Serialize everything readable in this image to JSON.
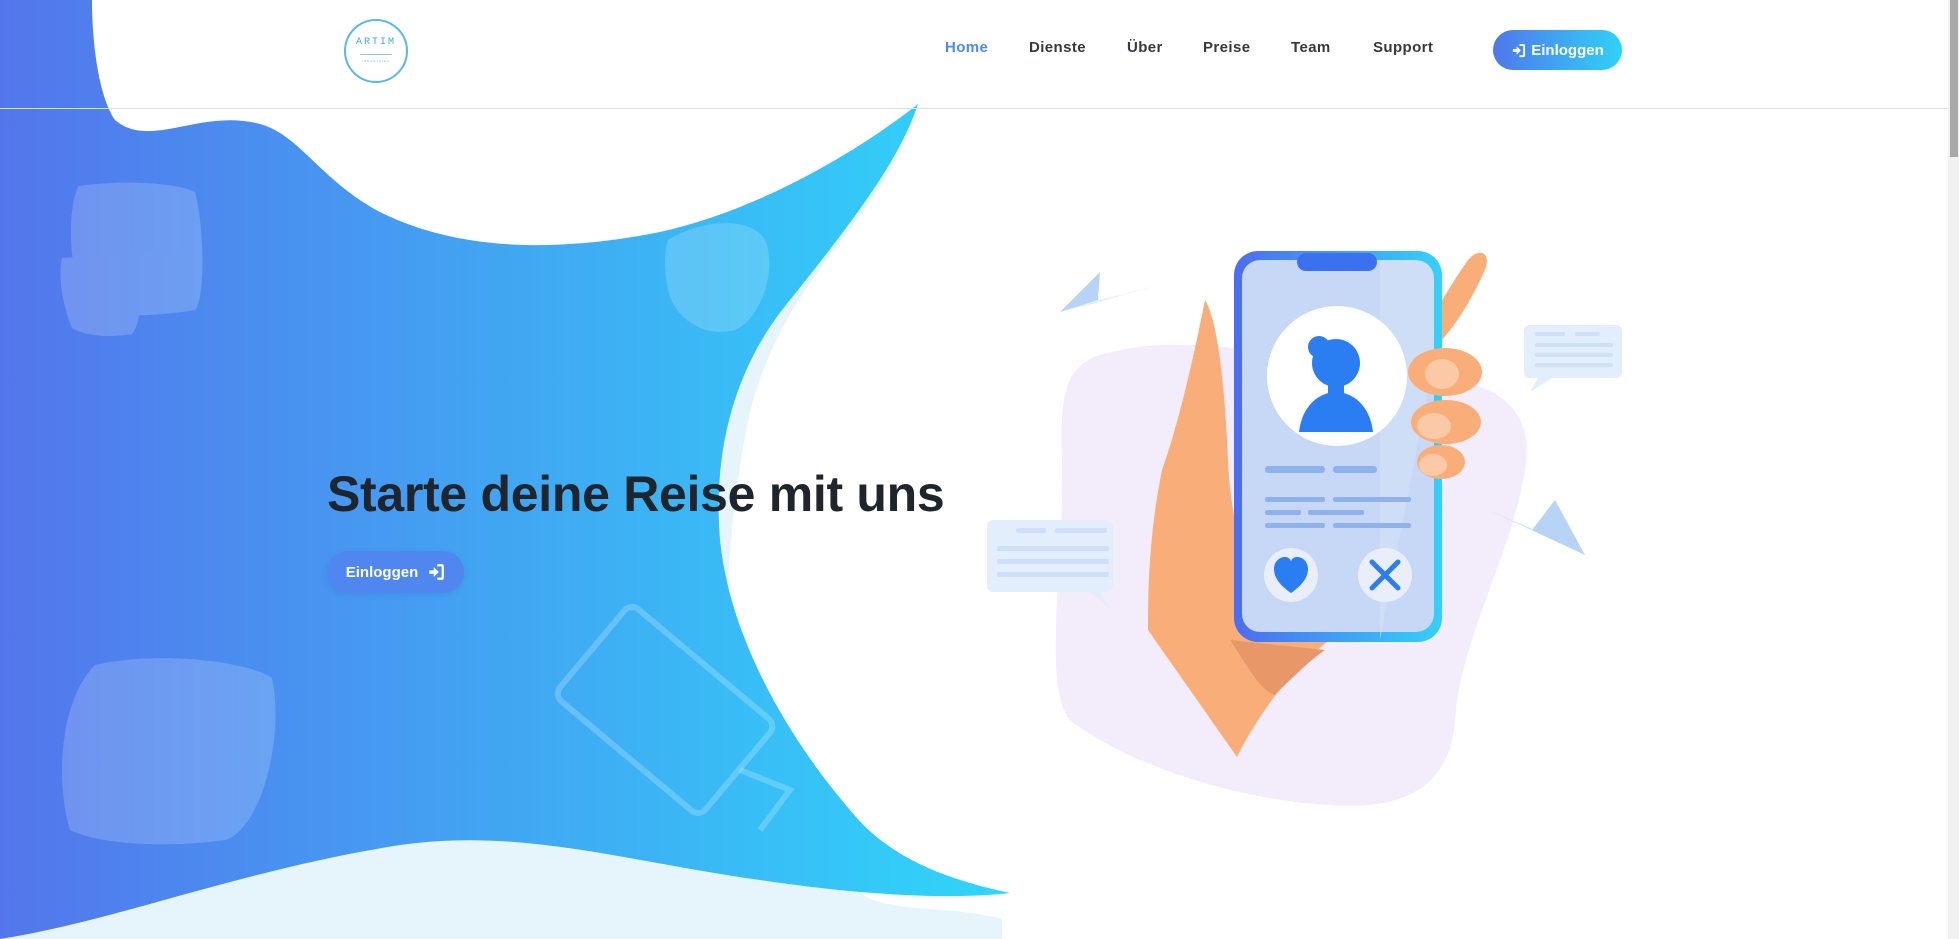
{
  "brand": {
    "logo_text": "ARTIM",
    "logo_subtext": "INDUSTRIES"
  },
  "nav": {
    "items": [
      {
        "label": "Home",
        "active": true
      },
      {
        "label": "Dienste",
        "active": false
      },
      {
        "label": "Über",
        "active": false
      },
      {
        "label": "Preise",
        "active": false
      },
      {
        "label": "Team",
        "active": false
      },
      {
        "label": "Support",
        "active": false
      }
    ],
    "login_label": "Einloggen",
    "login_icon": "sign-in-icon"
  },
  "hero": {
    "title": "Starte deine Reise mit uns",
    "button_label": "Einloggen",
    "button_icon": "sign-in-icon"
  },
  "illustration": {
    "name": "dating-app-phone-illustration",
    "actions": [
      "heart-icon",
      "close-icon"
    ]
  },
  "colors": {
    "gradient_start": "#5376ec",
    "gradient_end": "#2fd6f9",
    "nav_active": "#4a8cf0",
    "title": "#1f242d",
    "phone_accent": "#2b7ef2",
    "hand": "#f9ae79",
    "blob": "#f2ecfb"
  }
}
